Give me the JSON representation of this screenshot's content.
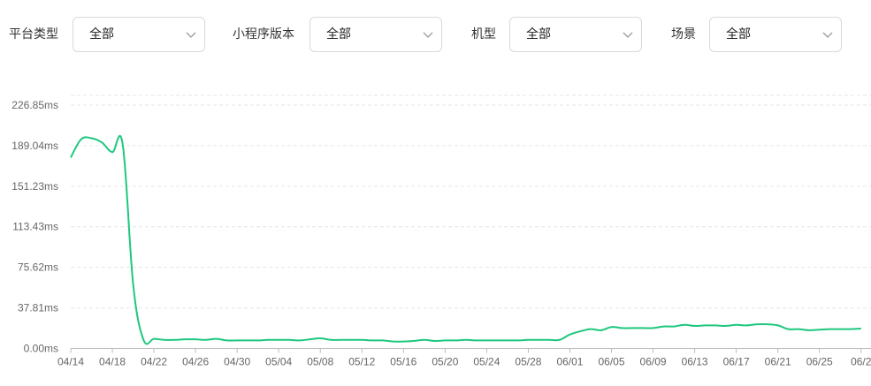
{
  "filters": [
    {
      "label": "平台类型",
      "value": "全部"
    },
    {
      "label": "小程序版本",
      "value": "全部"
    },
    {
      "label": "机型",
      "value": "全部"
    },
    {
      "label": "场景",
      "value": "全部"
    }
  ],
  "chart_data": {
    "type": "line",
    "yunit": "ms",
    "ylim": [
      0,
      226.85
    ],
    "yticks": [
      "0.00ms",
      "37.81ms",
      "75.62ms",
      "113.43ms",
      "151.23ms",
      "189.04ms",
      "226.85ms"
    ],
    "xticks": [
      "04/14",
      "04/18",
      "04/22",
      "04/26",
      "04/30",
      "05/04",
      "05/08",
      "05/12",
      "05/16",
      "05/20",
      "05/24",
      "05/28",
      "06/01",
      "06/05",
      "06/09",
      "06/13",
      "06/17",
      "06/21",
      "06/25",
      "06/2"
    ],
    "grid": true,
    "line_color": "#1ec77f",
    "series": [
      {
        "x": [
          "04/14",
          "04/15",
          "04/16",
          "04/17",
          "04/18",
          "04/19",
          "04/20",
          "04/21",
          "04/22",
          "04/23",
          "04/24",
          "04/25",
          "04/26",
          "04/27",
          "04/28",
          "04/29",
          "04/30",
          "05/01",
          "05/02",
          "05/03",
          "05/04",
          "05/05",
          "05/06",
          "05/07",
          "05/08",
          "05/09",
          "05/10",
          "05/11",
          "05/12",
          "05/13",
          "05/14",
          "05/15",
          "05/16",
          "05/17",
          "05/18",
          "05/19",
          "05/20",
          "05/21",
          "05/22",
          "05/23",
          "05/24",
          "05/25",
          "05/26",
          "05/27",
          "05/28",
          "05/29",
          "05/30",
          "05/31",
          "06/01",
          "06/02",
          "06/03",
          "06/04",
          "06/05",
          "06/06",
          "06/07",
          "06/08",
          "06/09",
          "06/10",
          "06/11",
          "06/12",
          "06/13",
          "06/14",
          "06/15",
          "06/16",
          "06/17",
          "06/18",
          "06/19",
          "06/20",
          "06/21",
          "06/22",
          "06/23",
          "06/24",
          "06/25",
          "06/26",
          "06/27",
          "06/28",
          "06/29"
        ],
        "values": [
          178,
          195,
          196,
          192,
          183,
          190,
          60,
          8,
          9,
          8,
          8,
          8.5,
          8.5,
          8,
          9,
          7.5,
          7.5,
          7.5,
          7.5,
          8,
          8,
          8,
          7.5,
          8.5,
          9.5,
          8,
          8,
          8,
          8,
          7.5,
          7.5,
          6.5,
          6.5,
          7,
          8,
          7,
          7.5,
          7.5,
          8,
          7.5,
          7.5,
          7.5,
          7.5,
          7.5,
          8,
          8,
          8,
          8,
          13,
          16,
          18,
          17,
          20,
          19,
          19,
          19,
          19,
          20.5,
          20.5,
          22,
          21,
          21.5,
          21.5,
          21,
          22,
          21.5,
          22.5,
          22.5,
          21.5,
          18,
          18,
          17,
          17.5,
          18,
          18,
          18,
          18.5
        ]
      }
    ]
  }
}
